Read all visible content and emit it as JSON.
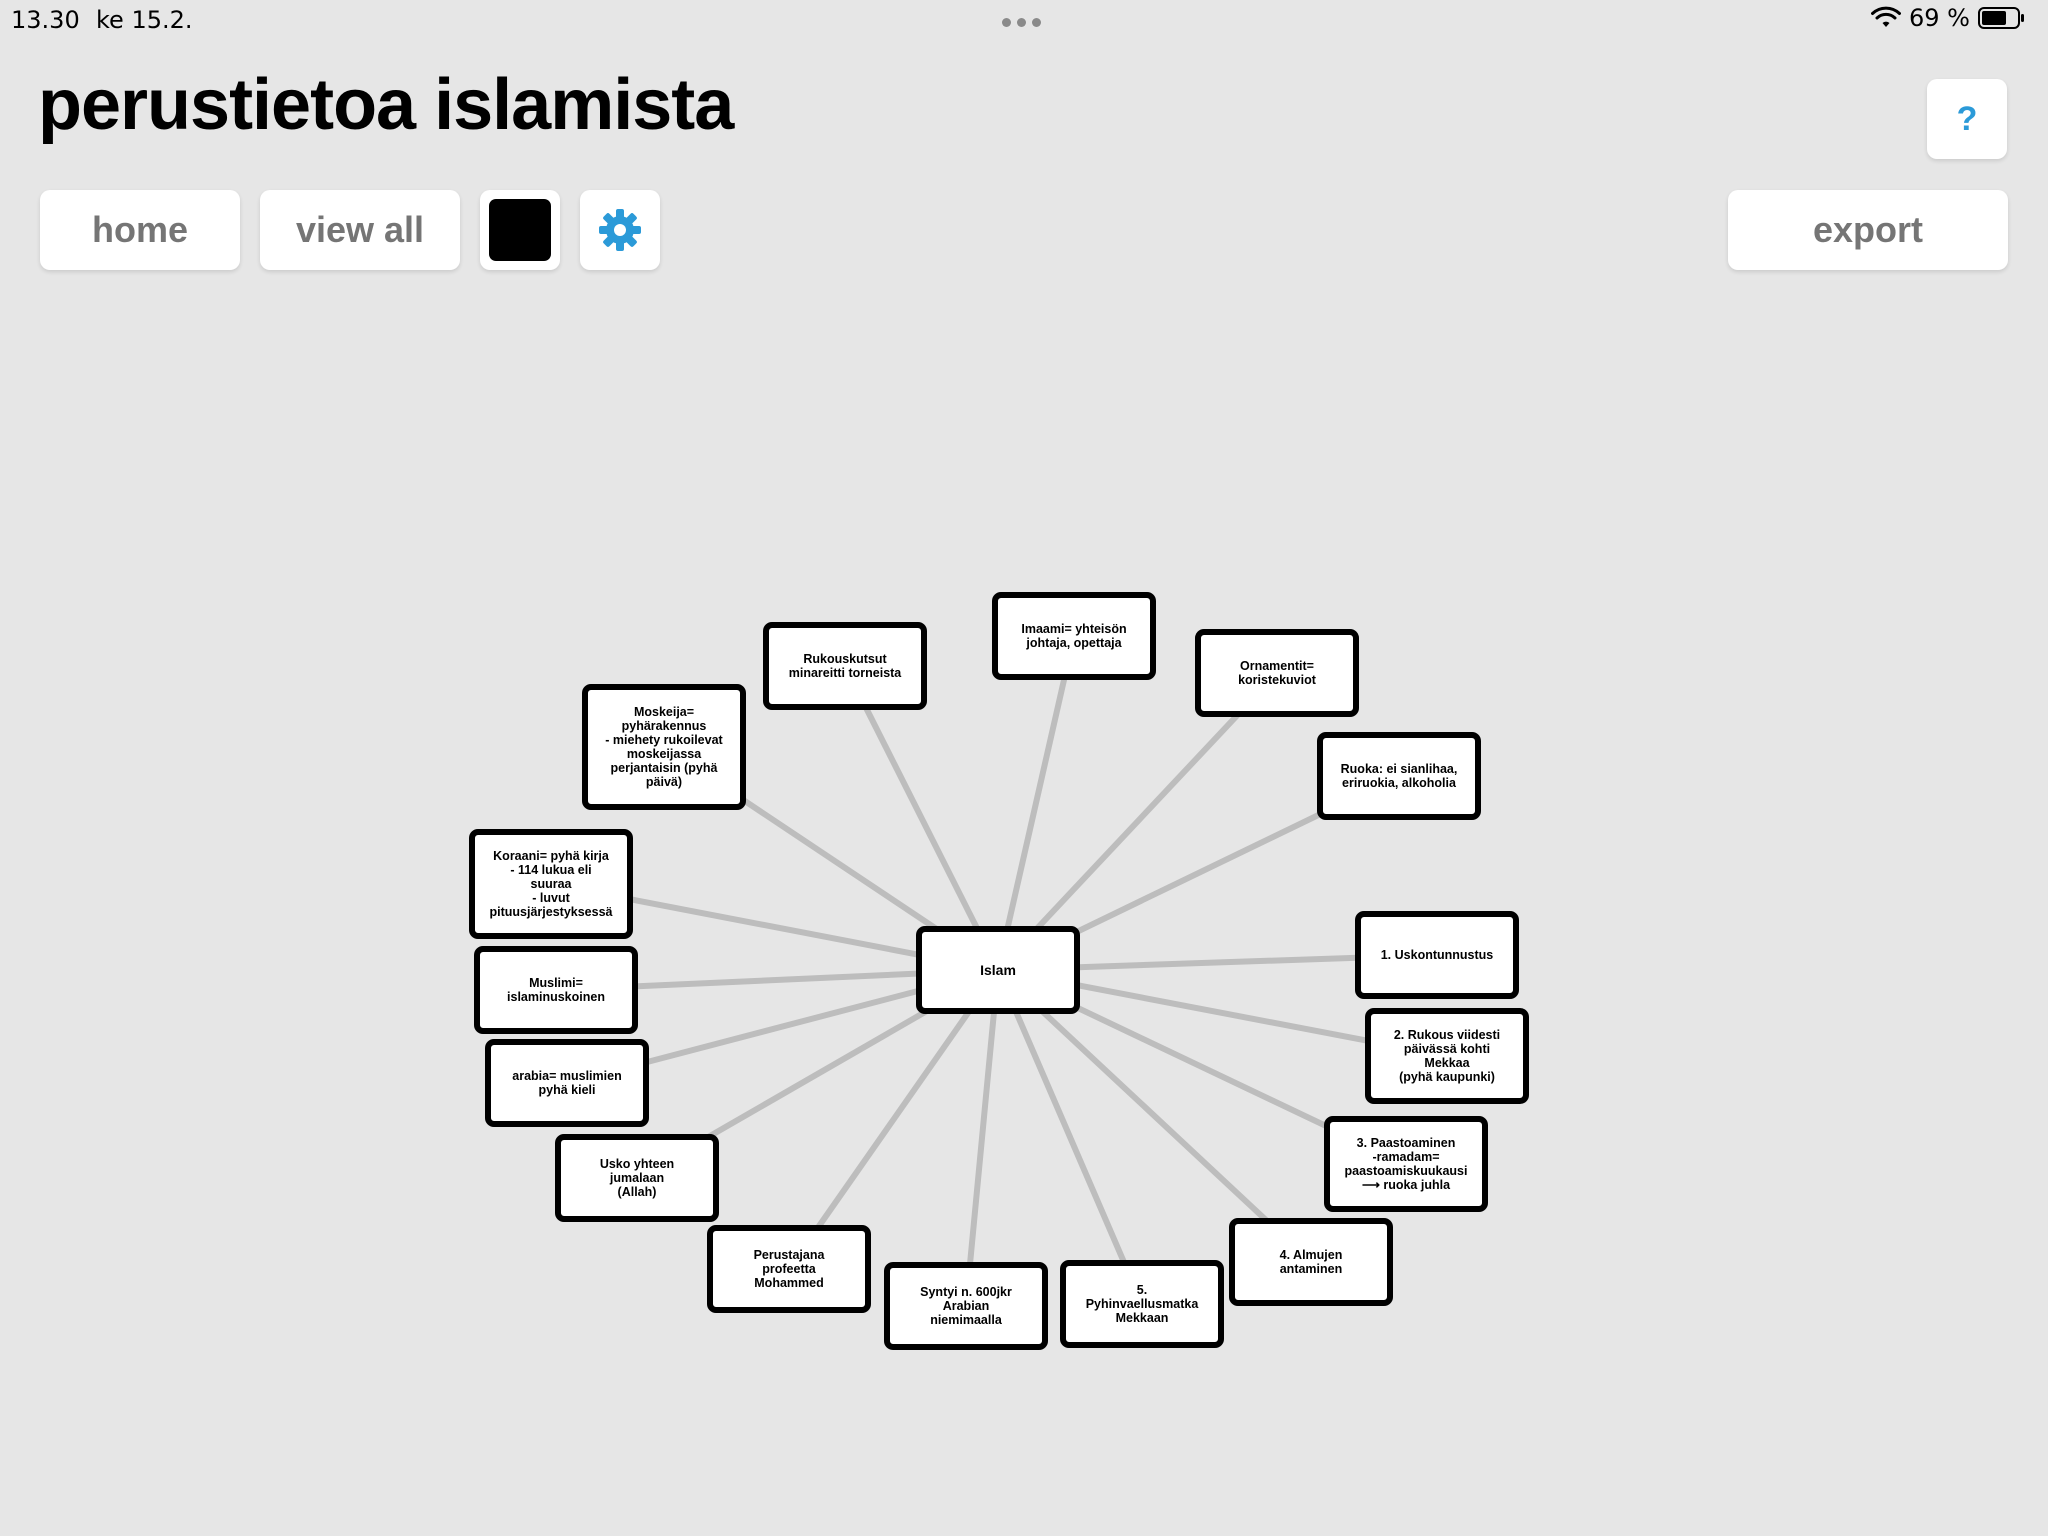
{
  "status_bar": {
    "time": "13.30",
    "date": "ke 15.2.",
    "battery": "69 %"
  },
  "header": {
    "title": "perustietoa islamista",
    "help_label": "?"
  },
  "toolbar": {
    "home_label": "home",
    "view_all_label": "view all",
    "export_label": "export",
    "color_swatch": "#000000",
    "settings_icon": "gear-icon",
    "accent_color": "#2b9ad8"
  },
  "mindmap": {
    "center": "Islam",
    "nodes": [
      "Imaami= yhteisön\njohtaja, opettaja",
      "Ornamentit=\nkoristekuviot",
      "Ruoka: ei sianlihaa,\neriruokia, alkoholia",
      "1. Uskontunnustus",
      "2. Rukous viidesti\npäivässä kohti\nMekkaa\n(pyhä kaupunki)",
      "3. Paastoaminen\n-ramadam=\npaastoamiskuukausi\n⟶ ruoka juhla",
      "4. Almujen\nantaminen",
      "5.\nPyhinvaellusmatka\nMekkaan",
      "Syntyi n. 600jkr\nArabian\nniemimaalla",
      "Perustajana\nprofeetta\nMohammed",
      "Usko yhteen\njumalaan\n(Allah)",
      "arabia= muslimien\npyhä kieli",
      "Muslimi=\nislaminuskoinen",
      "Koraani= pyhä kirja\n- 114 lukua eli\nsuuraa\n- luvut\npituusjärjestyksessä",
      "Moskeija=\npyhärakennus\n- miehety rukoilevat\nmoskeijassa\nperjantaisin (pyhä\npäivä)",
      "Rukouskutsut\nminareitti torneista"
    ]
  }
}
